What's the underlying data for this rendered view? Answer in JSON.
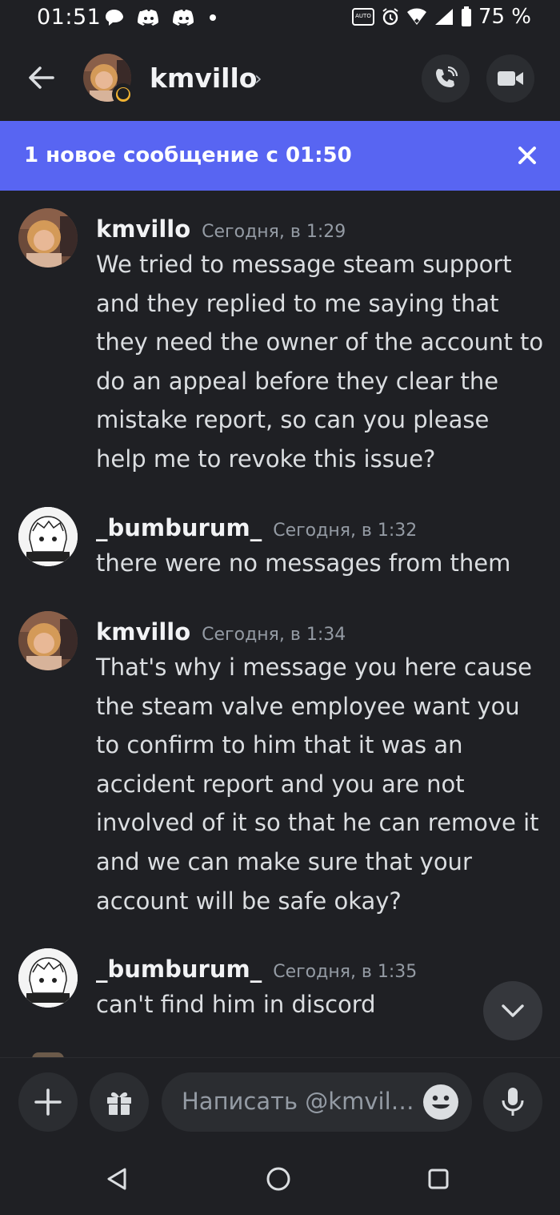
{
  "status_bar": {
    "time": "01:51",
    "battery": "75 %",
    "left_icons": [
      "chat-bubble-icon",
      "discord-icon",
      "discord-icon",
      "dot-icon"
    ],
    "right_icons": [
      "auto-hz-icon",
      "alarm-icon",
      "wifi-icon",
      "signal-icon",
      "battery-icon"
    ]
  },
  "header": {
    "username": "kmvillo",
    "chevron": "›",
    "status": "idle"
  },
  "banner": {
    "text": "1 новое сообщение с 01:50"
  },
  "messages": [
    {
      "author": "kmvillo",
      "time": "Сегодня, в 1:29",
      "text": "We tried to message steam support and they replied to me saying that they need the owner of the account to do an appeal before they clear the mistake report, so can you please help me to revoke this issue?"
    },
    {
      "author": "_bumburum_",
      "time": "Сегодня, в 1:32",
      "text": "there were no messages from them"
    },
    {
      "author": "kmvillo",
      "time": "Сегодня, в 1:34",
      "text": "That's why i message you here cause the steam valve employee want you to confirm to him that it was an  accident report and you are not involved of it so that he can remove it and we can make sure that your account will be safe okay?"
    },
    {
      "author": "_bumburum_",
      "time": "Сегодня, в 1:35",
      "text": "can't find him in discord"
    }
  ],
  "composer": {
    "placeholder": "Написать @kmvil…"
  },
  "colors": {
    "background": "#1f2024",
    "banner": "#5865f2",
    "idle_status": "#f0b232"
  }
}
